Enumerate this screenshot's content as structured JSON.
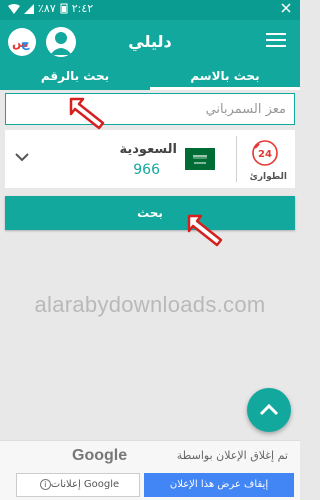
{
  "status_bar": {
    "time": "٢:٤٢",
    "battery": "٨٧٪"
  },
  "app_bar": {
    "title": "دليلي"
  },
  "tabs": [
    {
      "label": "بحث بالرقم",
      "active": false
    },
    {
      "label": "بحث بالاسم",
      "active": true
    }
  ],
  "search": {
    "value": "معز السمرباني"
  },
  "country": {
    "name": "السعودية",
    "code": "966"
  },
  "emergency": {
    "label": "الطوارئ",
    "badge": "24"
  },
  "search_button": {
    "label": "بحث"
  },
  "watermark": "alarabydownloads.com",
  "ad": {
    "message": "تم إغلاق الإعلان بواسطة",
    "provider": "Google",
    "stop_label": "إيقاف عرض هذا الإعلان",
    "google_ads_label": "إعلانات Google"
  },
  "colors": {
    "primary": "#13a89e",
    "status": "#0a9c90",
    "arrow": "#d62020"
  }
}
